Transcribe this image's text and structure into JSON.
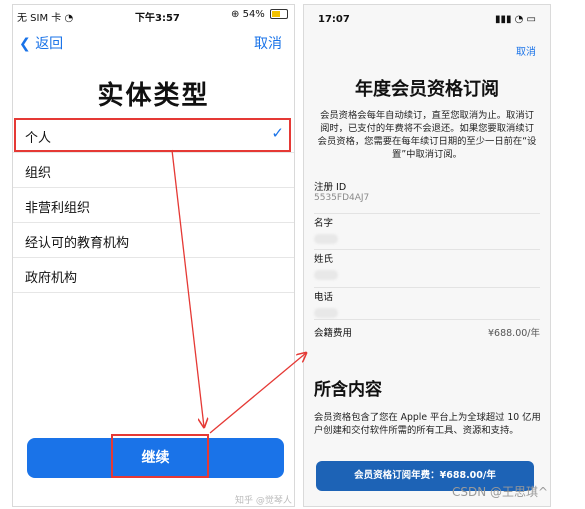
{
  "left_screen": {
    "status_bar": {
      "carrier": "无 SIM 卡",
      "time": "下午3:57",
      "battery": "54%"
    },
    "nav": {
      "back_label": "返回",
      "cancel_label": "取消"
    },
    "title": "实体类型",
    "entity_types": [
      {
        "label": "个人",
        "selected": true
      },
      {
        "label": "组织",
        "selected": false
      },
      {
        "label": "非营利组织",
        "selected": false
      },
      {
        "label": "经认可的教育机构",
        "selected": false
      },
      {
        "label": "政府机构",
        "selected": false
      }
    ],
    "checkmark": "✓",
    "continue_label": "继续",
    "watermark": "知乎 @觉琴人"
  },
  "right_screen": {
    "status_bar": {
      "time": "17:07"
    },
    "cancel_label": "取消",
    "title": "年度会员资格订阅",
    "description": "会员资格会每年自动续订，直至您取消为止。取消订阅时，已支付的年费将不会退还。如果您要取消续订会员资格，您需要在每年续订日期的至少一日前在“设置”中取消订阅。",
    "fields": [
      {
        "label": "注册 ID",
        "value": "5535FD4AJ7"
      },
      {
        "label": "名字",
        "value": ""
      },
      {
        "label": "姓氏",
        "value": ""
      },
      {
        "label": "电话",
        "value": ""
      }
    ],
    "fee": {
      "label": "会籍费用",
      "value": "¥688.00/年"
    },
    "section_title": "所含内容",
    "section_desc": "会员资格包含了您在 Apple 平台上为全球超过 10 亿用户创建和交付软件所需的所有工具、资源和支持。",
    "subscribe_label": "会员资格订阅年费：¥688.00/年"
  },
  "watermark": "CSDN @王思琪^",
  "colors": {
    "accent": "#1a73e8",
    "highlight": "#e53935",
    "subscribe_button": "#1d63b6"
  }
}
